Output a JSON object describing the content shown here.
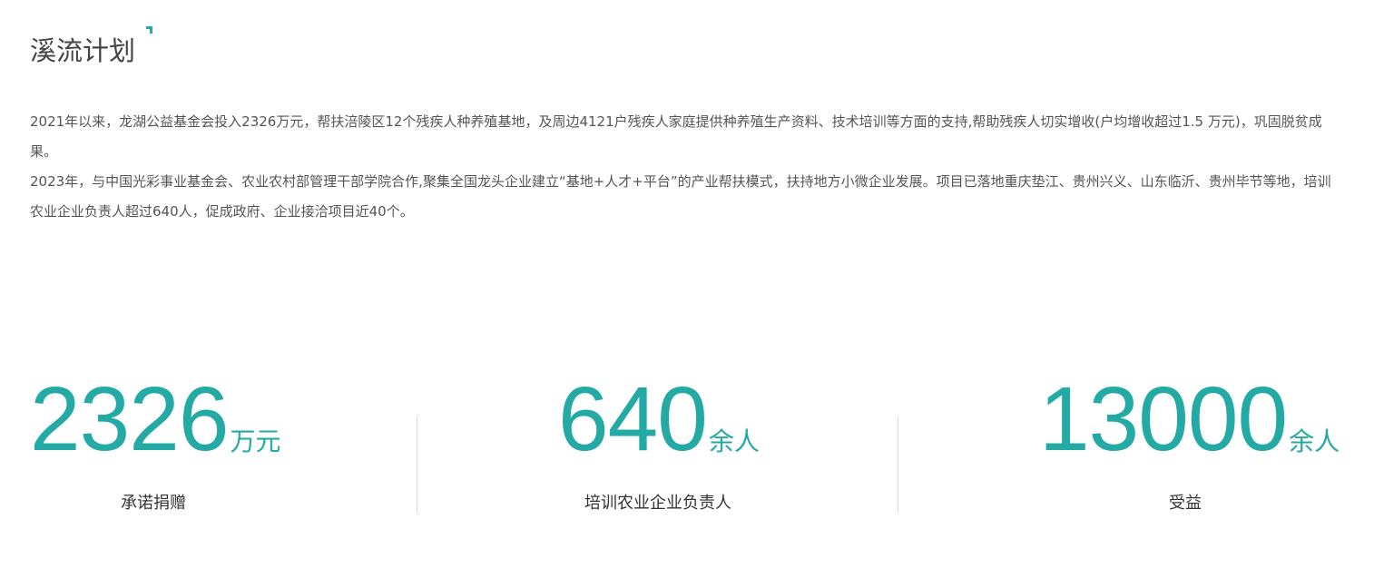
{
  "header": {
    "title": "溪流计划"
  },
  "intro": {
    "paragraph_1": "2021年以来，龙湖公益基金会投入2326万元，帮扶涪陵区12个残疾人种养殖基地，及周边4121户残疾人家庭提供种养殖生产资料、技术培训等方面的支持,帮助残疾人切实增收(户均增收超过1.5 万元)，巩固脱贫成果。",
    "paragraph_2": "2023年，与中国光彩事业基金会、农业农村部管理干部学院合作,聚集全国龙头企业建立“基地+人才+平台”的产业帮扶模式，扶持地方小微企业发展。项目已落地重庆垫江、贵州兴义、山东临沂、贵州毕节等地，培训农业企业负责人超过640人，促成政府、企业接洽项目近40个。"
  },
  "stats": [
    {
      "number": "2326",
      "unit": "万元",
      "label": "承诺捐赠"
    },
    {
      "number": "640",
      "unit": "余人",
      "label": "培训农业企业负责人"
    },
    {
      "number": "13000",
      "unit": "余人",
      "label": "受益"
    }
  ],
  "colors": {
    "accent": "#23aaa5",
    "text": "#444444",
    "divider": "#dcdcdc"
  }
}
